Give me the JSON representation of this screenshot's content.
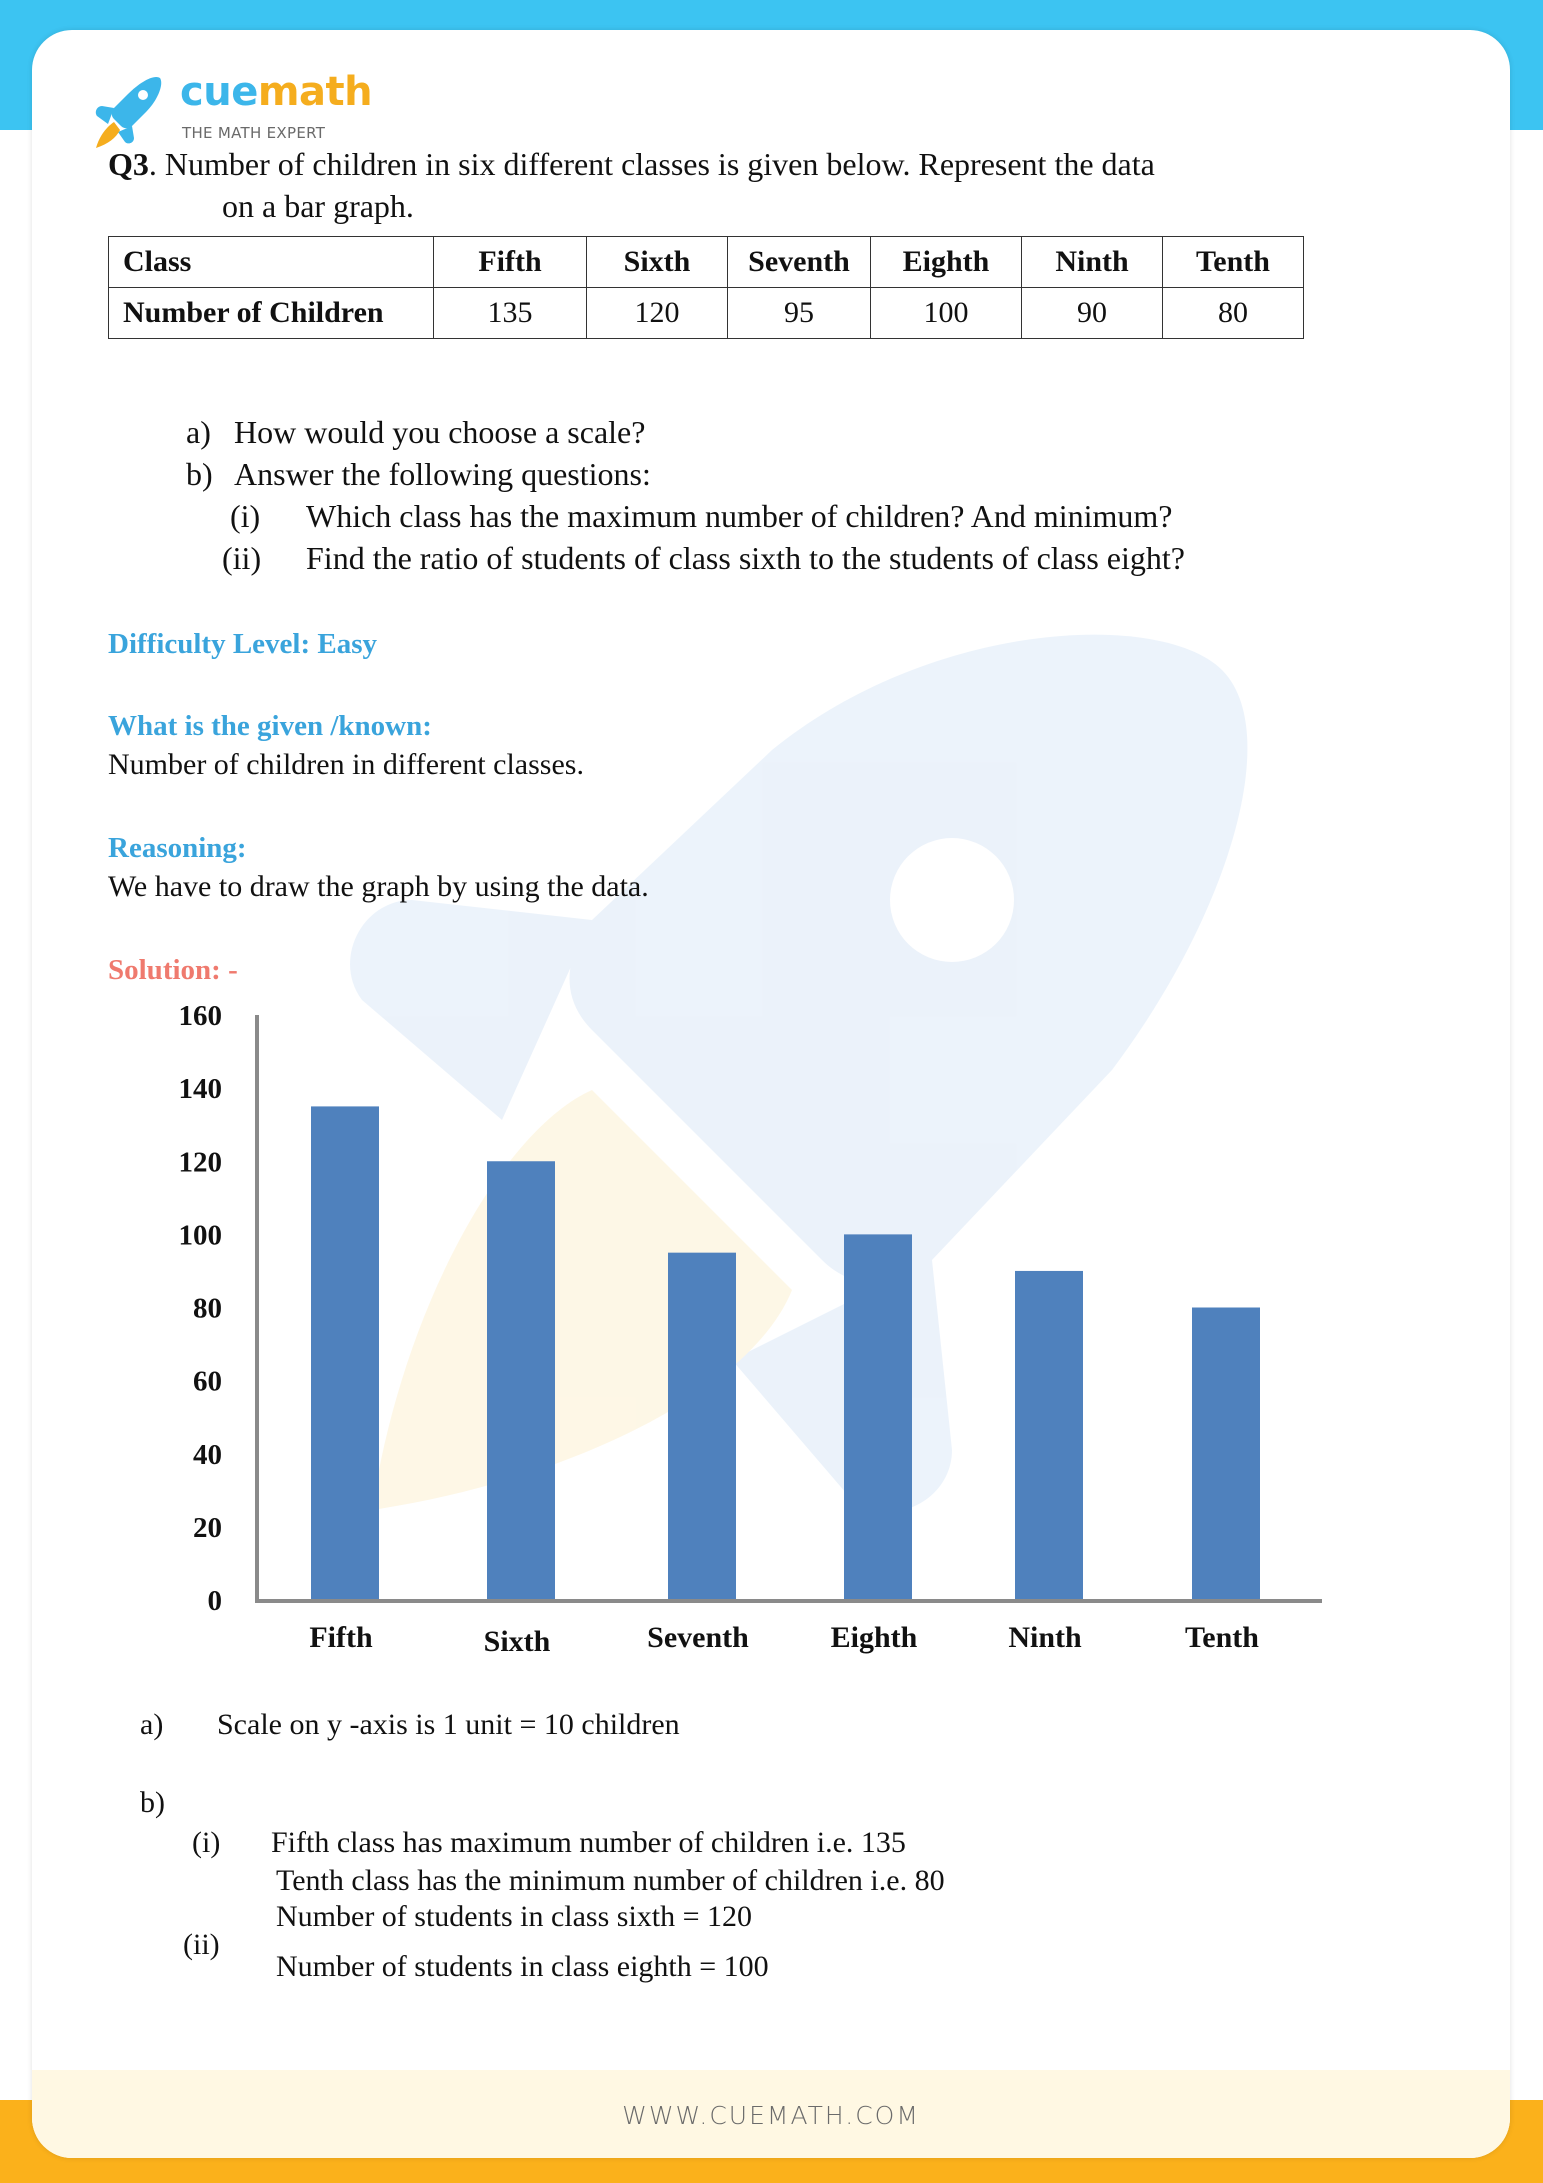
{
  "brand": {
    "name_part1": "cue",
    "name_part2": "math",
    "tagline": "THE MATH EXPERT",
    "footer_url": "WWW.CUEMATH.COM",
    "colors": {
      "blue": "#3cc4f2",
      "orange": "#fbb11b",
      "heading_blue": "#3aa4dc",
      "solution_red": "#ef7a6e",
      "bar": "#4f81bd"
    }
  },
  "question": {
    "number": "Q3",
    "line1": ".  Number of children in six different classes is given below. Represent the data",
    "line2": "on a bar graph."
  },
  "table": {
    "header_label": "Class",
    "row_label": "Number of Children",
    "columns": [
      "Fifth",
      "Sixth",
      "Seventh",
      "Eighth",
      "Ninth",
      "Tenth"
    ],
    "values": [
      "135",
      "120",
      "95",
      "100",
      "90",
      "80"
    ]
  },
  "sub_questions": {
    "a_marker": "a)",
    "a_text": "How would you choose a scale?",
    "b_marker": "b)",
    "b_text": "Answer the following questions:",
    "i_marker": "(i)",
    "i_text": "Which class has the maximum number of children? And minimum?",
    "ii_marker": "(ii)",
    "ii_text": "Find the ratio of students of class sixth to the students of class eight?"
  },
  "sections": {
    "difficulty": "Difficulty Level: Easy",
    "given_heading": "What is the given /known:",
    "given_text": "Number of children in different classes.",
    "reasoning_heading": "Reasoning:",
    "reasoning_text": "We have to draw the graph by using the data.",
    "solution_heading": "Solution: -"
  },
  "chart_data": {
    "type": "bar",
    "title": "",
    "xlabel": "",
    "ylabel": "",
    "categories": [
      "Fifth",
      "Sixth",
      "Seventh",
      "Eighth",
      "Ninth",
      "Tenth"
    ],
    "values": [
      135,
      120,
      95,
      100,
      90,
      80
    ],
    "ylim": [
      0,
      160
    ],
    "yticks": [
      0,
      20,
      40,
      60,
      80,
      100,
      120,
      140,
      160
    ],
    "ytick_labels": [
      "0",
      "20",
      "40",
      "60",
      "80",
      "100",
      "120",
      "140",
      "160"
    ],
    "grid": false,
    "legend": "none",
    "bar_color": "#4f81bd"
  },
  "answers": {
    "a_marker": "a)",
    "a_text": "Scale on y -axis is 1 unit = 10 children",
    "b_marker": "b)",
    "i_marker": "(i)",
    "i_line1": "Fifth class has maximum number of children i.e. 135",
    "i_line2": "Tenth class has the minimum number of children i.e. 80",
    "ii_marker": "(ii)",
    "ii_line1": "Number of students in class sixth = 120",
    "ii_line2": "Number of students in class eighth = 100"
  }
}
